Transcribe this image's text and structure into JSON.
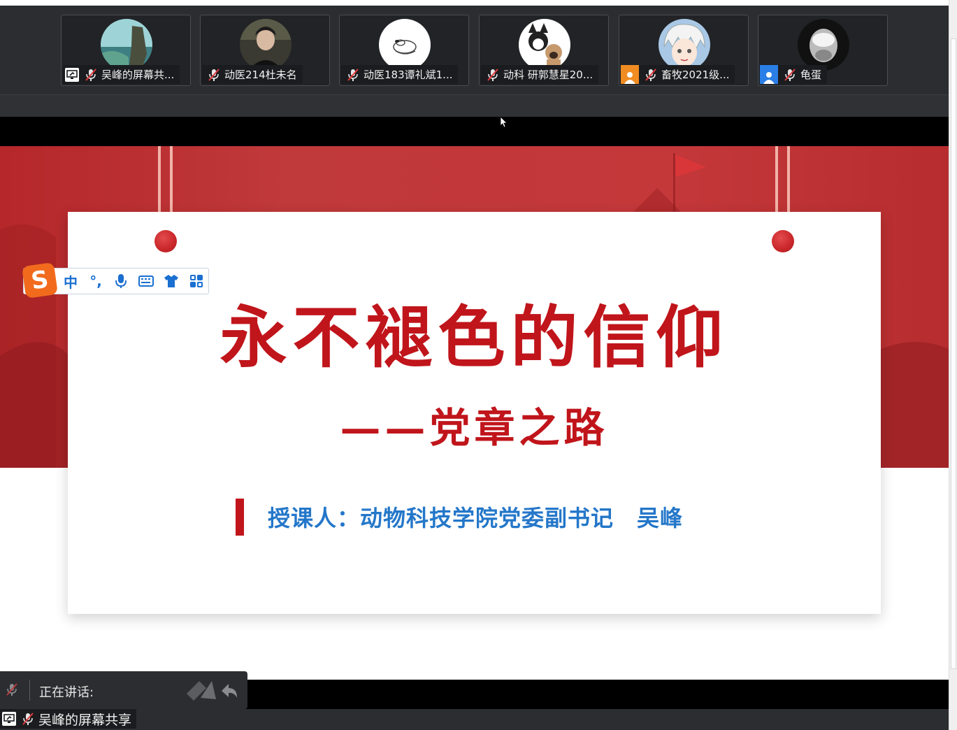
{
  "participants": [
    {
      "name": "吴峰的屏幕共...",
      "badge": "screen-share",
      "muted": true,
      "avatar": "avatar-landscape-icon"
    },
    {
      "name": "动医214杜未名",
      "badge": "none",
      "muted": true,
      "avatar": "avatar-person-icon"
    },
    {
      "name": "动医183谭礼斌1...",
      "badge": "none",
      "muted": true,
      "avatar": "avatar-snoopy-icon"
    },
    {
      "name": "动科 研郭慧星20...",
      "badge": "none",
      "muted": true,
      "avatar": "avatar-dogs-icon"
    },
    {
      "name": "畜牧2021级...",
      "badge": "person-orange",
      "muted": true,
      "avatar": "avatar-anime-icon"
    },
    {
      "name": "龟蛋",
      "badge": "person-blue",
      "muted": true,
      "avatar": "avatar-glass-icon"
    }
  ],
  "slide": {
    "title": "永不褪色的信仰",
    "subtitle": "——党章之路",
    "lecturer": "授课人：动物科技学院党委副书记　吴峰"
  },
  "ime": {
    "logo": "S",
    "mode": "中",
    "punct": "°,"
  },
  "speaking": {
    "label": "正在讲话:"
  },
  "share_status": {
    "label": "吴峰的屏幕共享"
  },
  "colors": {
    "title_red": "#c0151b",
    "lecturer_blue": "#2477c9",
    "bar_dark": "#2b2d30",
    "ime_orange": "#f26b1d"
  }
}
